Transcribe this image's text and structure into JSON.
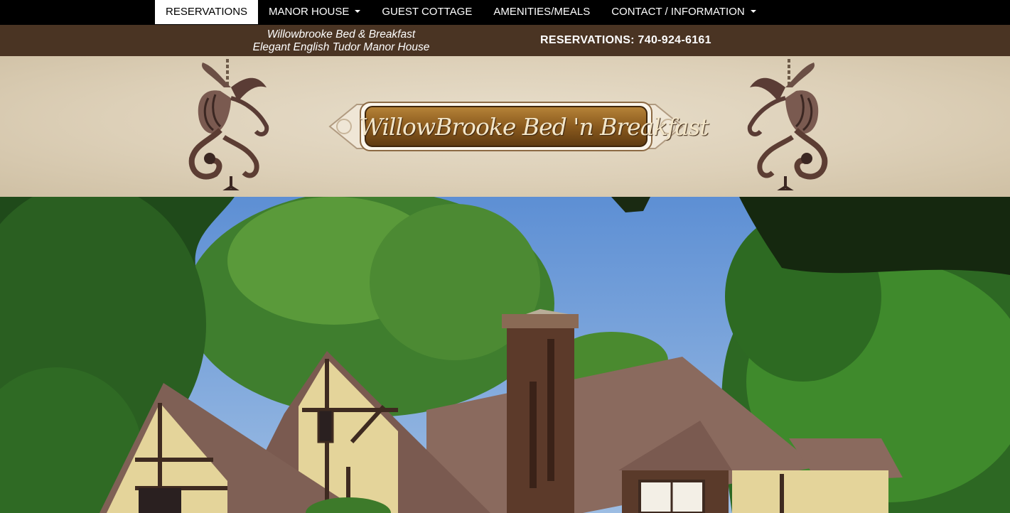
{
  "nav": {
    "items": [
      {
        "label": "RESERVATIONS",
        "active": true,
        "dropdown": false
      },
      {
        "label": "MANOR HOUSE",
        "active": false,
        "dropdown": true
      },
      {
        "label": "GUEST COTTAGE",
        "active": false,
        "dropdown": false
      },
      {
        "label": "AMENITIES/MEALS",
        "active": false,
        "dropdown": false
      },
      {
        "label": "CONTACT / INFORMATION",
        "active": false,
        "dropdown": true
      }
    ]
  },
  "infobar": {
    "tagline_line1": "Willowbrooke Bed & Breakfast",
    "tagline_line2": "Elegant English Tudor Manor House",
    "phone": "RESERVATIONS: 740-924-6161"
  },
  "banner": {
    "logo_text": "WillowBrooke Bed 'n Breakfast"
  },
  "colors": {
    "nav_bg": "#000000",
    "infobar_bg": "#4a3423",
    "banner_bg": "#ddd0b8",
    "logo_plate": "#8a5a1e"
  }
}
